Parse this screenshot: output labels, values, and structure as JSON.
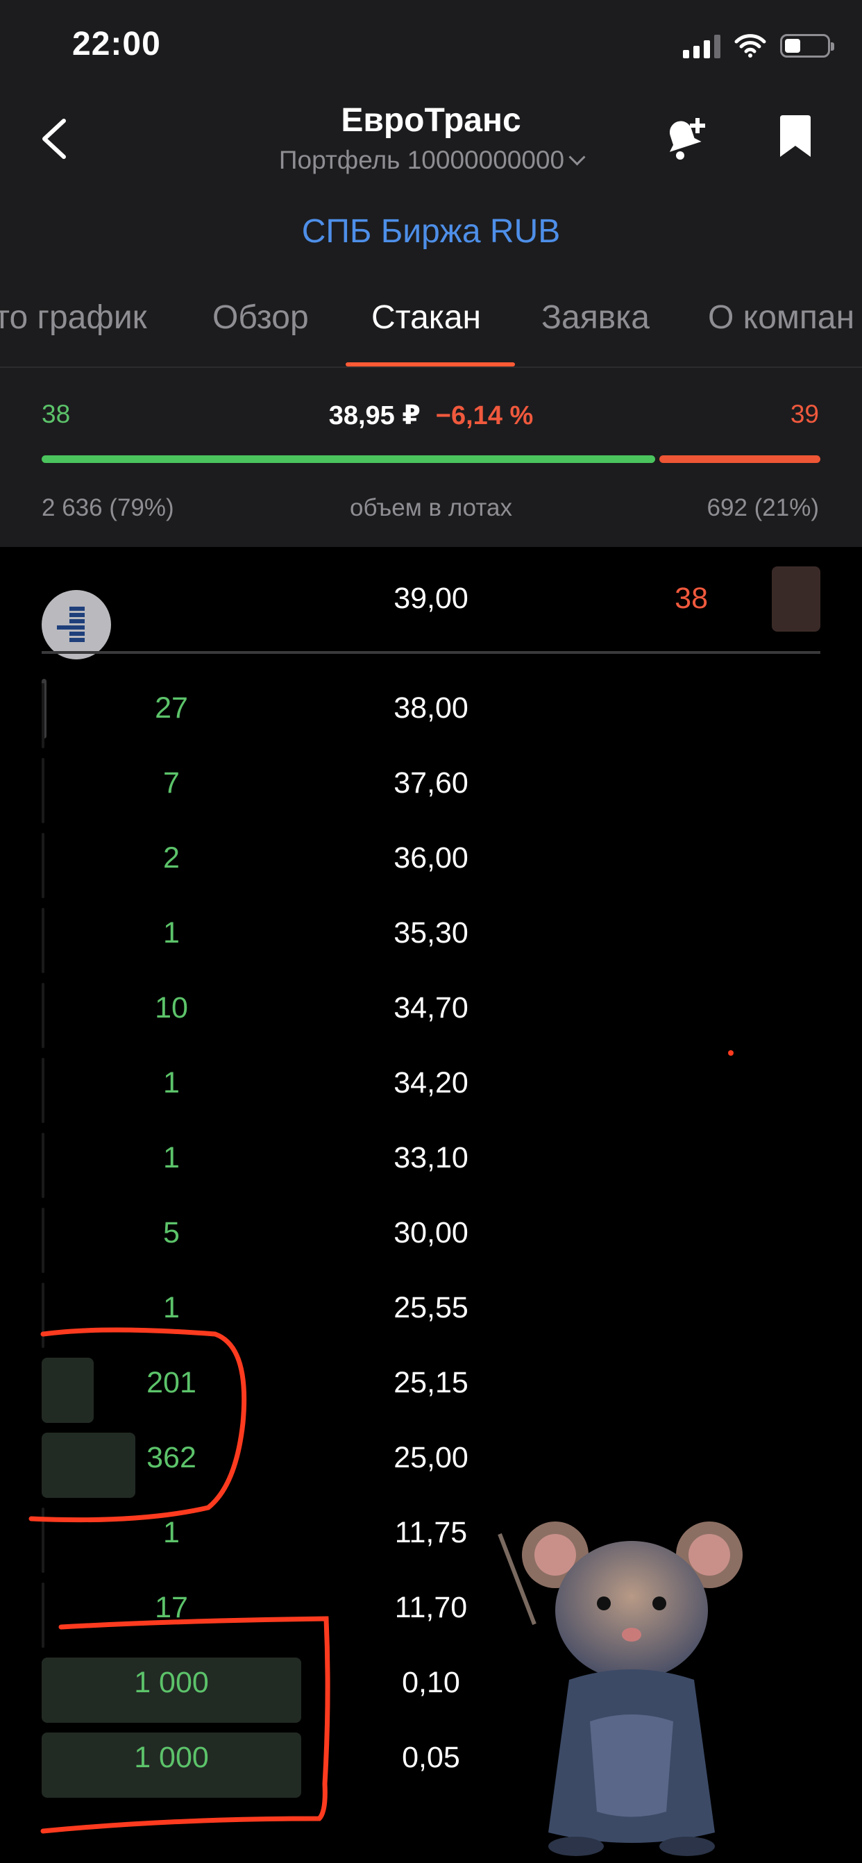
{
  "status_bar": {
    "time": "22:00"
  },
  "header": {
    "title": "ЕвроТранс",
    "subtitle": "Портфель 10000000000",
    "exchange": "СПБ Биржа RUB"
  },
  "tabs": [
    "то график",
    "Обзор",
    "Стакан",
    "Заявка",
    "О компан"
  ],
  "active_tab": "Стакан",
  "summary": {
    "bid": "38",
    "ask": "39",
    "last_price": "38,95 ₽",
    "change": "−6,14 %",
    "bid_volume": "2 636 (79%)",
    "ask_volume": "692 (21%)",
    "volume_caption": "объем в лотах",
    "bid_share": 0.79
  },
  "asks": [
    {
      "price": "39,00",
      "qty": "38"
    }
  ],
  "bids": [
    {
      "qty": "27",
      "price": "38,00",
      "bar": 0
    },
    {
      "qty": "7",
      "price": "37,60",
      "bar": 0
    },
    {
      "qty": "2",
      "price": "36,00",
      "bar": 0
    },
    {
      "qty": "1",
      "price": "35,30",
      "bar": 0
    },
    {
      "qty": "10",
      "price": "34,70",
      "bar": 0
    },
    {
      "qty": "1",
      "price": "34,20",
      "bar": 0
    },
    {
      "qty": "1",
      "price": "33,10",
      "bar": 0
    },
    {
      "qty": "5",
      "price": "30,00",
      "bar": 0
    },
    {
      "qty": "1",
      "price": "25,55",
      "bar": 0
    },
    {
      "qty": "201",
      "price": "25,15",
      "bar": 0.201
    },
    {
      "qty": "362",
      "price": "25,00",
      "bar": 0.362
    },
    {
      "qty": "1",
      "price": "11,75",
      "bar": 0
    },
    {
      "qty": "17",
      "price": "11,70",
      "bar": 0
    },
    {
      "qty": "1 000",
      "price": "0,10",
      "bar": 1
    },
    {
      "qty": "1 000",
      "price": "0,05",
      "bar": 1
    }
  ],
  "colors": {
    "header_bg": "#1c1c1e",
    "accent_blue": "#4e8fe9",
    "accent_orange": "#ff5a36",
    "bid_green": "#5cc36a",
    "ask_red": "#f0593d",
    "annotation_red": "#ff3b1f"
  },
  "icons": [
    "back-chevron-icon",
    "alert-add-icon",
    "bookmark-icon",
    "orderbook-icon",
    "chevron-down-icon"
  ]
}
